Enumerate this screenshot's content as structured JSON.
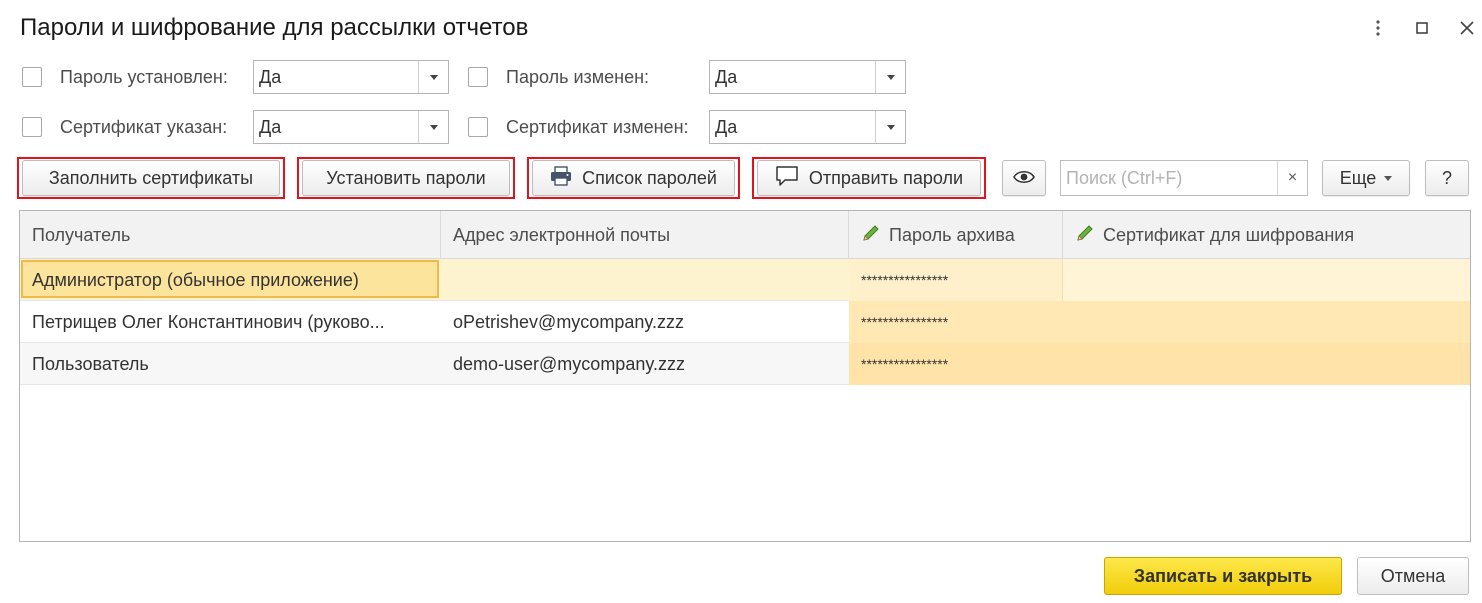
{
  "window": {
    "title": "Пароли и шифрование для рассылки отчетов"
  },
  "filters": {
    "password_set": {
      "label": "Пароль установлен:",
      "value": "Да",
      "checked": false
    },
    "password_changed": {
      "label": "Пароль изменен:",
      "value": "Да",
      "checked": false
    },
    "certificate_specified": {
      "label": "Сертификат указан:",
      "value": "Да",
      "checked": false
    },
    "certificate_changed": {
      "label": "Сертификат изменен:",
      "value": "Да",
      "checked": false
    }
  },
  "toolbar": {
    "fill_certificates": "Заполнить сертификаты",
    "set_passwords": "Установить пароли",
    "password_list": "Список паролей",
    "send_passwords": "Отправить пароли",
    "search_placeholder": "Поиск (Ctrl+F)",
    "search_clear": "×",
    "more": "Еще",
    "help": "?"
  },
  "table": {
    "columns": [
      {
        "label": "Получатель",
        "editable": false
      },
      {
        "label": "Адрес электронной почты",
        "editable": false
      },
      {
        "label": "Пароль архива",
        "editable": true
      },
      {
        "label": "Сертификат для шифрования",
        "editable": true
      }
    ],
    "rows": [
      {
        "recipient": "Администратор (обычное приложение)",
        "email": "",
        "password": "****************",
        "certificate": "",
        "selected": true
      },
      {
        "recipient": "Петрищев Олег Константинович (руково...",
        "email": "oPetrishev@mycompany.zzz",
        "password": "****************",
        "certificate": ""
      },
      {
        "recipient": "Пользователь",
        "email": "demo-user@mycompany.zzz",
        "password": "****************",
        "certificate": ""
      }
    ]
  },
  "footer": {
    "save_close": "Записать и закрыть",
    "cancel": "Отмена"
  },
  "colors": {
    "accent_yellow": "#f5d21c",
    "selected_row": "#fdf3cf",
    "editable_column": "#ffe8b3",
    "highlight_border": "#e3121b"
  }
}
